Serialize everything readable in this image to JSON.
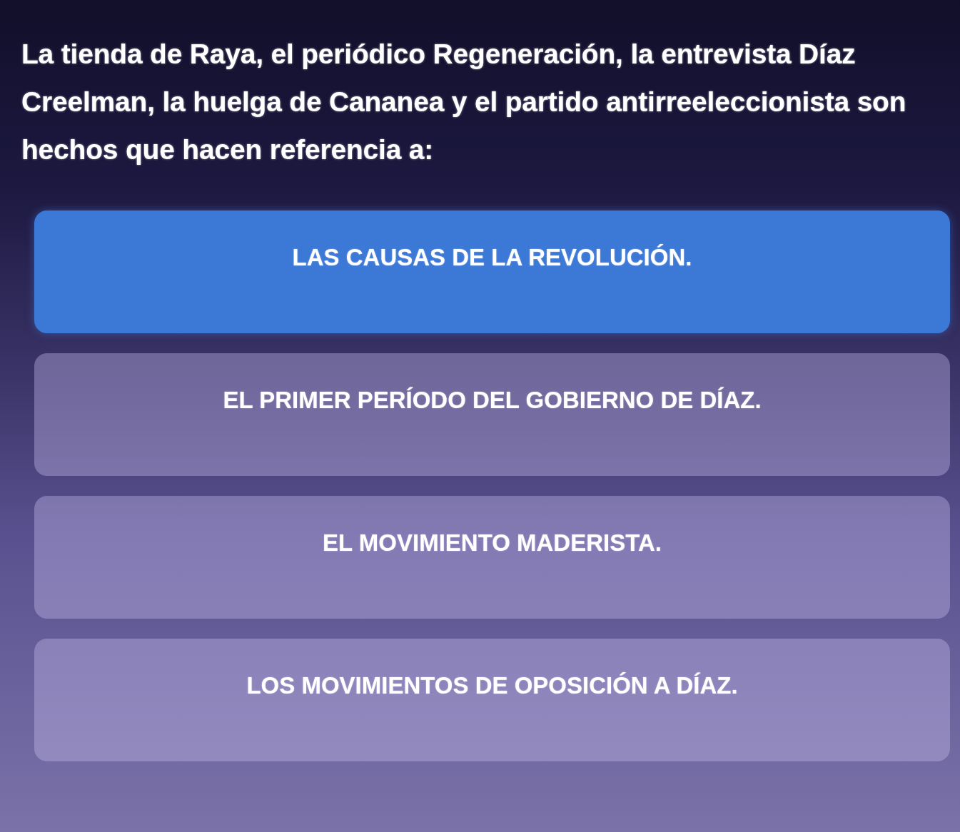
{
  "question": {
    "text": "La tienda de Raya, el periódico Regeneración, la entrevista Díaz Creelman, la huelga de Cananea y el partido antirreeleccionista son hechos que hacen referencia a:"
  },
  "options": [
    {
      "label": "LAS CAUSAS DE LA REVOLUCIÓN.",
      "selected": true
    },
    {
      "label": "EL PRIMER PERÍODO DEL GOBIERNO DE DÍAZ.",
      "selected": false
    },
    {
      "label": "EL MOVIMIENTO MADERISTA.",
      "selected": false
    },
    {
      "label": "LOS MOVIMIENTOS DE OPOSICIÓN A DÍAZ.",
      "selected": false
    }
  ]
}
